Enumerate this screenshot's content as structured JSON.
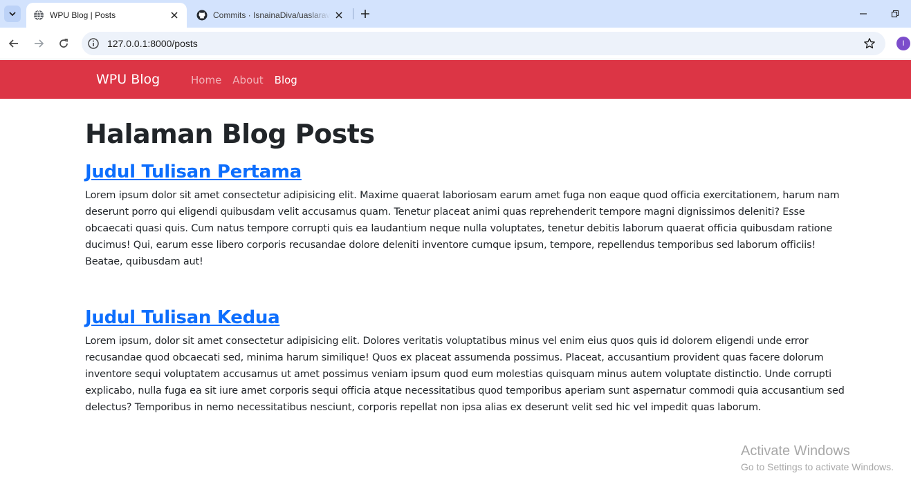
{
  "browser": {
    "tabs": [
      {
        "title": "WPU Blog | Posts",
        "favicon": "globe-icon",
        "active": true
      },
      {
        "title": "Commits · IsnainaDiva/uaslaravel",
        "favicon": "github-icon",
        "active": false
      }
    ],
    "address": {
      "url": "127.0.0.1:8000/posts"
    },
    "profile_initial": "I"
  },
  "navbar": {
    "brand": "WPU Blog",
    "links": [
      {
        "label": "Home",
        "active": false
      },
      {
        "label": "About",
        "active": false
      },
      {
        "label": "Blog",
        "active": true
      }
    ],
    "color": "#dc3545"
  },
  "page": {
    "title": "Halaman Blog Posts",
    "posts": [
      {
        "title": "Judul Tulisan Pertama",
        "body": "Lorem ipsum dolor sit amet consectetur adipisicing elit. Maxime quaerat laboriosam earum amet fuga non eaque quod officia exercitationem, harum nam deserunt porro qui eligendi quibusdam velit accusamus quam. Tenetur placeat animi quas reprehenderit tempore magni dignissimos deleniti? Esse obcaecati quasi quis. Cum natus tempore corrupti quis ea laudantium neque nulla voluptates, tenetur debitis laborum quaerat officia quibusdam ratione ducimus! Qui, earum esse libero corporis recusandae dolore deleniti inventore cumque ipsum, tempore, repellendus temporibus sed laborum officiis! Beatae, quibusdam aut!"
      },
      {
        "title": "Judul Tulisan Kedua",
        "body": "Lorem ipsum, dolor sit amet consectetur adipisicing elit. Dolores veritatis voluptatibus minus vel enim eius quos quis id dolorem eligendi unde error recusandae quod obcaecati sed, minima harum similique! Quos ex placeat assumenda possimus. Placeat, accusantium provident quas facere dolorum inventore sequi voluptatem accusamus ut amet possimus veniam ipsum quod eum molestias quisquam minus autem voluptate distinctio. Unde corrupti explicabo, nulla fuga ea sit iure amet corporis sequi officia atque necessitatibus quod temporibus aperiam sunt aspernatur commodi quia accusantium sed delectus? Temporibus in nemo necessitatibus nesciunt, corporis repellat non ipsa alias ex deserunt velit sed hic vel impedit quas laborum."
      }
    ],
    "link_color": "#0d6efd"
  },
  "watermark": {
    "line1": "Activate Windows",
    "line2": "Go to Settings to activate Windows."
  }
}
